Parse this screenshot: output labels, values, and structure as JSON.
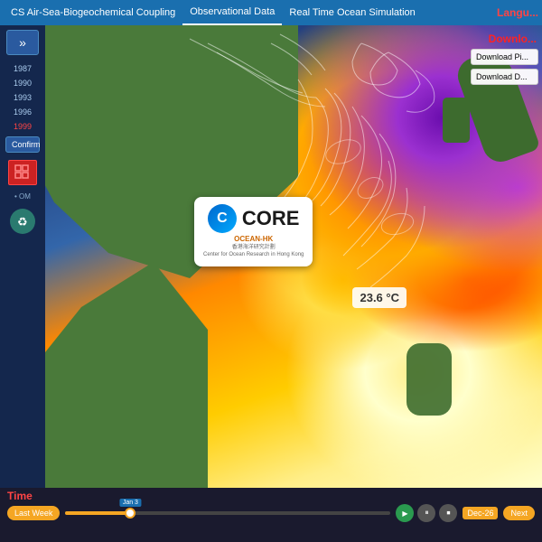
{
  "nav": {
    "items": [
      {
        "label": "CS Air-Sea-Biogeochemical Coupling",
        "active": false
      },
      {
        "label": "Observational Data",
        "active": true
      },
      {
        "label": "Real Time Ocean Simulation",
        "active": false
      }
    ],
    "language_label": "Langu..."
  },
  "sidebar": {
    "toggle_icon": "»",
    "years": [
      "1987",
      "1990",
      "1993",
      "1996",
      "1999"
    ],
    "confirm_label": "Confirm",
    "legend_label": "• OM",
    "selected_year": "1999"
  },
  "core_logo": {
    "c_letter": "C",
    "title": "CORE",
    "ocean_hk": "OCEAN-HK",
    "subtitle": "香港海洋研究計劃\nCenter for Ocean Research in Hong Kong"
  },
  "temperature": {
    "value": "23.6 °C"
  },
  "download": {
    "label": "Downlo...",
    "btn1": "Download Pi...",
    "btn2": "Download D..."
  },
  "time": {
    "label": "Time",
    "last_week_label": "Last Week",
    "date_marker": "Jan 3",
    "date_badge": "Dec-26",
    "next_label": "Next"
  }
}
